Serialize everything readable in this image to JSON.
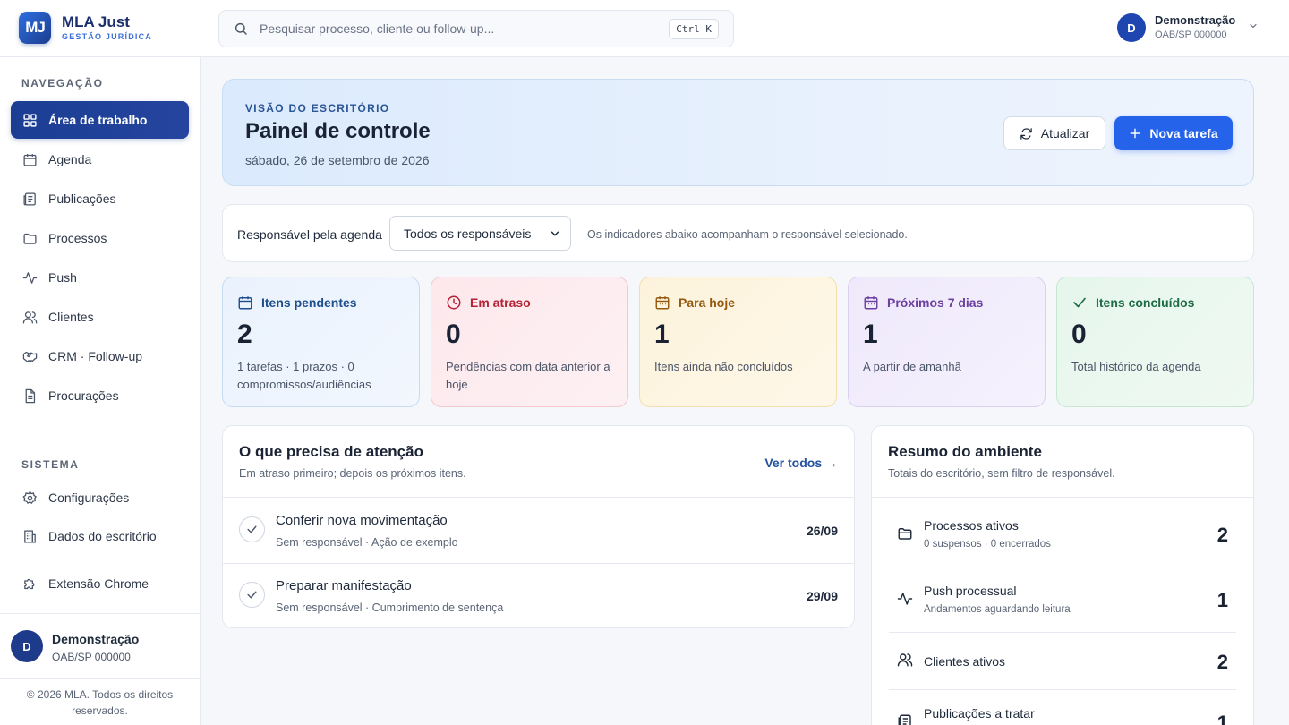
{
  "brand": {
    "logo": "MJ",
    "name": "MLA Just",
    "subtitle": "GESTÃO JURÍDICA"
  },
  "search": {
    "placeholder": "Pesquisar processo, cliente ou follow-up...",
    "value": "",
    "shortcut": "Ctrl K"
  },
  "user": {
    "initial": "D",
    "name": "Demonstração",
    "oab": "OAB/SP 000000"
  },
  "sidebar": {
    "nav_label": "NAVEGAÇÃO",
    "items": [
      {
        "label": "Área de trabalho",
        "icon": "grid-icon",
        "active": true
      },
      {
        "label": "Agenda",
        "icon": "calendar-icon"
      },
      {
        "label": "Publicações",
        "icon": "newspaper-icon"
      },
      {
        "label": "Processos",
        "icon": "folder-icon"
      },
      {
        "label": "Push",
        "icon": "activity-icon"
      },
      {
        "label": "Clientes",
        "icon": "users-icon"
      },
      {
        "label": "CRM · Follow-up",
        "icon": "handshake-icon"
      },
      {
        "label": "Procurações",
        "icon": "document-icon"
      }
    ],
    "system_label": "SISTEMA",
    "system_items": [
      {
        "label": "Configurações",
        "icon": "gear-icon"
      },
      {
        "label": "Dados do escritório",
        "icon": "building-icon"
      }
    ],
    "extension": {
      "label": "Extensão Chrome",
      "icon": "puzzle-icon"
    },
    "copyright": "© 2026 MLA. Todos os direitos reservados."
  },
  "hero": {
    "eyebrow": "VISÃO DO ESCRITÓRIO",
    "title": "Painel de controle",
    "date": "sábado, 26 de setembro de 2026",
    "refresh_label": "Atualizar",
    "new_task_label": "Nova tarefa"
  },
  "filter": {
    "label": "Responsável pela agenda",
    "selected": "Todos os responsáveis",
    "help": "Os indicadores abaixo acompanham o responsável selecionado."
  },
  "stats": [
    {
      "title": "Itens pendentes",
      "value": "2",
      "desc": "1 tarefas · 1 prazos · 0 compromissos/audiências",
      "icon": "calendar-icon",
      "color": "#1e4e8c"
    },
    {
      "title": "Em atraso",
      "value": "0",
      "desc": "Pendências com data anterior a hoje",
      "icon": "clock-icon",
      "color": "#b42335"
    },
    {
      "title": "Para hoje",
      "value": "1",
      "desc": "Itens ainda não concluídos",
      "icon": "calendar-icon",
      "color": "#94590f"
    },
    {
      "title": "Próximos 7 dias",
      "value": "1",
      "desc": "A partir de amanhã",
      "icon": "calendar-icon",
      "color": "#6b3fa0"
    },
    {
      "title": "Itens concluídos",
      "value": "0",
      "desc": "Total histórico da agenda",
      "icon": "check-icon",
      "color": "#1d6b45"
    }
  ],
  "attention": {
    "title": "O que precisa de atenção",
    "subtitle": "Em atraso primeiro; depois os próximos itens.",
    "see_all": "Ver todos →",
    "tasks": [
      {
        "title": "Conferir nova movimentação",
        "meta": "Sem responsável · Ação de exemplo",
        "date": "26/09"
      },
      {
        "title": "Preparar manifestação",
        "meta": "Sem responsável · Cumprimento de sentença",
        "date": "29/09"
      }
    ]
  },
  "environment": {
    "title": "Resumo do ambiente",
    "subtitle": "Totais do escritório, sem filtro de responsável.",
    "rows": [
      {
        "title": "Processos ativos",
        "sub": "0 suspensos · 0 encerrados",
        "value": "2",
        "icon": "folder-icon"
      },
      {
        "title": "Push processual",
        "sub": "Andamentos aguardando leitura",
        "value": "1",
        "icon": "activity-icon"
      },
      {
        "title": "Clientes ativos",
        "sub": "",
        "value": "2",
        "icon": "users-icon"
      },
      {
        "title": "Publicações a tratar",
        "sub": "",
        "value": "1",
        "icon": "newspaper-icon"
      }
    ]
  }
}
